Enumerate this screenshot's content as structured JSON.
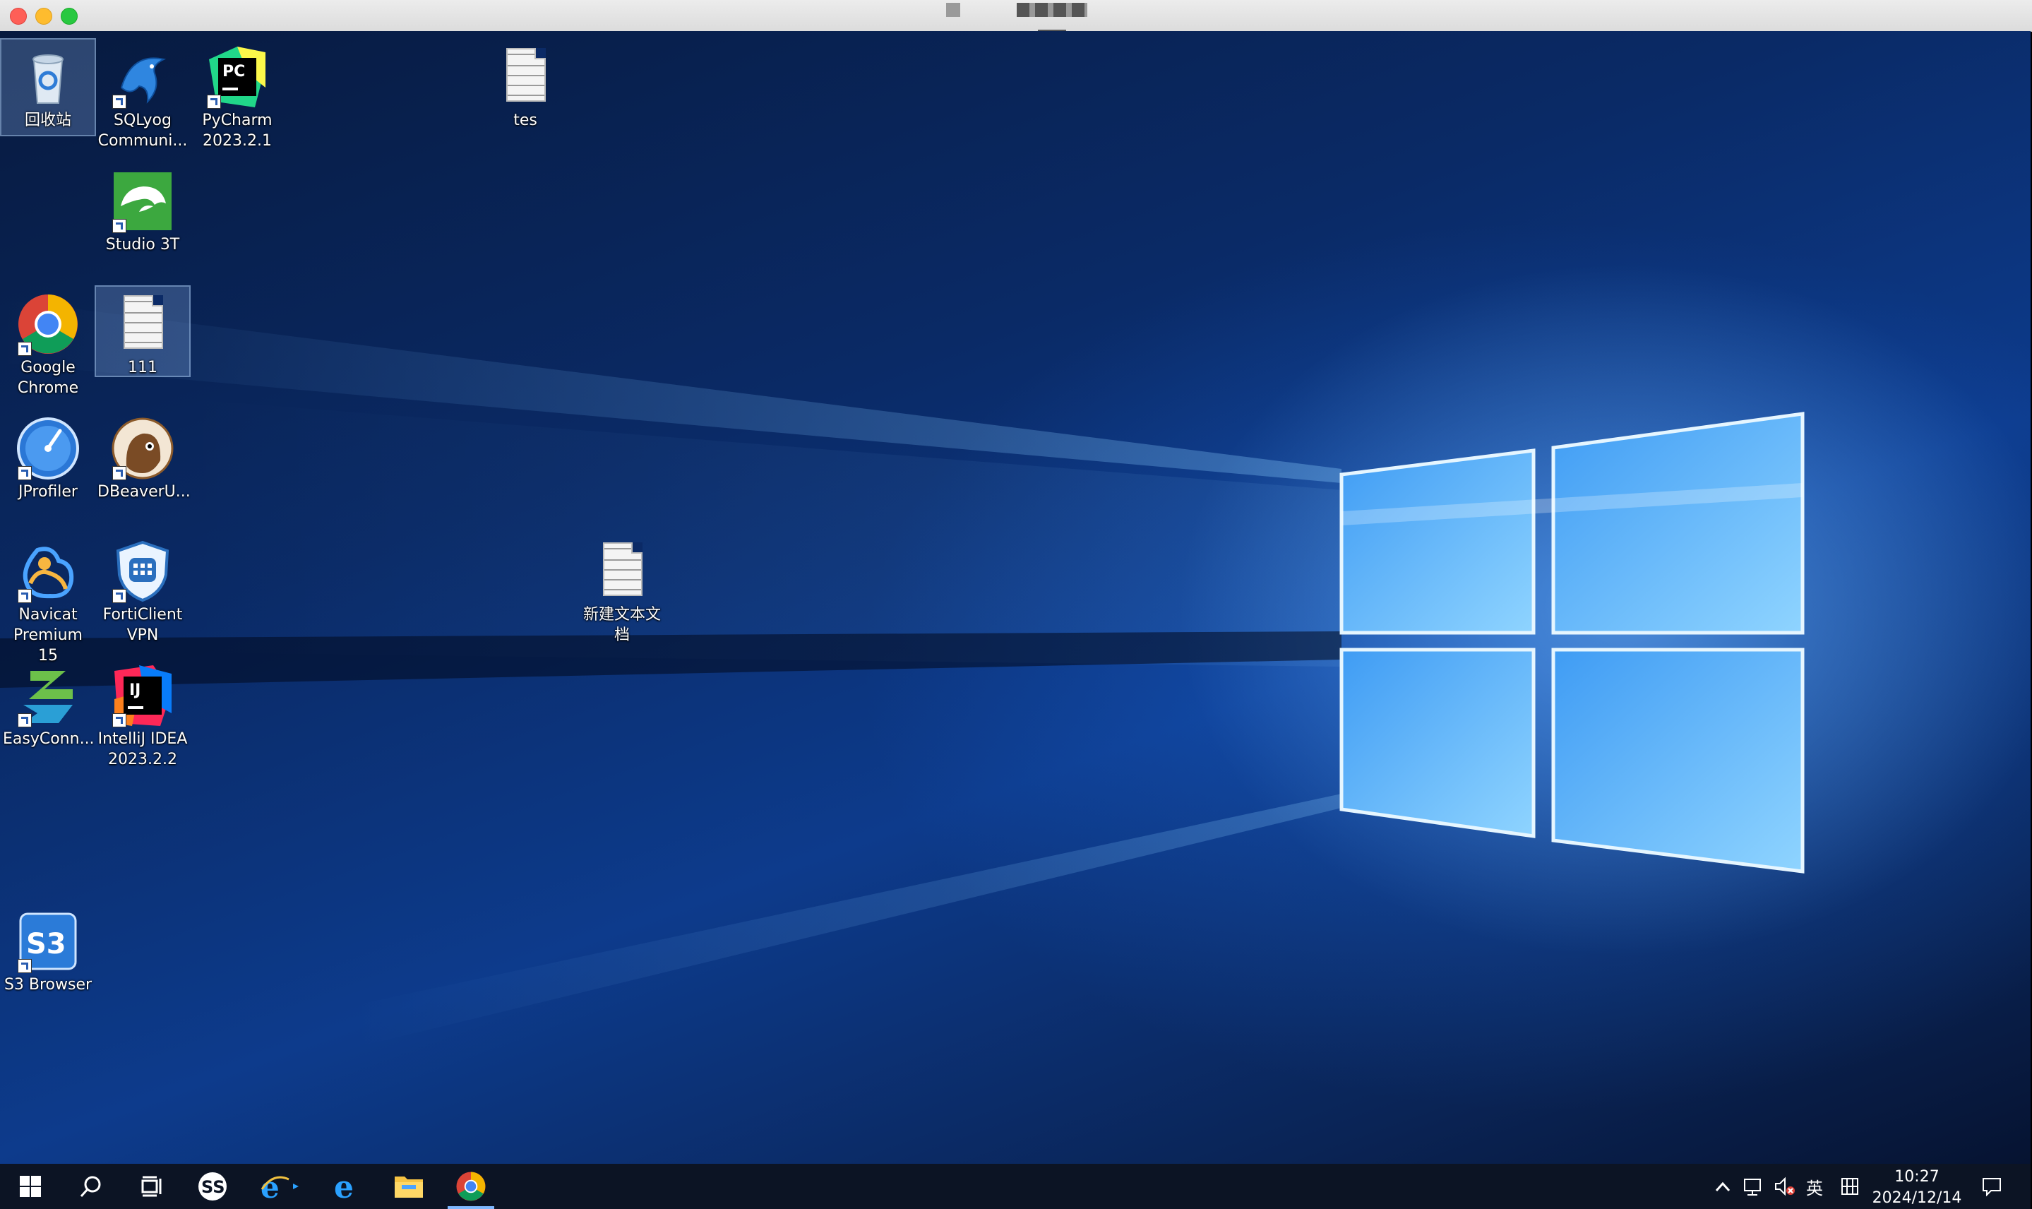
{
  "window": {
    "controls": [
      "close",
      "minimize",
      "maximize"
    ]
  },
  "desktop": {
    "icons": [
      {
        "id": "recycle-bin",
        "label": "回收站",
        "icon": "recycle-bin-icon",
        "shortcut": false,
        "selected": true
      },
      {
        "id": "sqlyog",
        "label": "SQLyog\nCommuni...",
        "icon": "sqlyog-dolphin-icon",
        "shortcut": true
      },
      {
        "id": "pycharm",
        "label": "PyCharm\n2023.2.1",
        "icon": "pycharm-icon",
        "shortcut": true
      },
      {
        "id": "tes",
        "label": "tes",
        "icon": "text-file-icon",
        "shortcut": false
      },
      {
        "id": "studio3t",
        "label": "Studio 3T",
        "icon": "studio3t-icon",
        "shortcut": true
      },
      {
        "id": "chrome",
        "label": "Google\nChrome",
        "icon": "chrome-icon",
        "shortcut": true
      },
      {
        "id": "file111",
        "label": "111",
        "icon": "text-file-icon",
        "shortcut": false,
        "selected": true
      },
      {
        "id": "jprofiler",
        "label": "JProfiler",
        "icon": "jprofiler-icon",
        "shortcut": true
      },
      {
        "id": "dbeaver",
        "label": "DBeaverU...",
        "icon": "dbeaver-icon",
        "shortcut": true
      },
      {
        "id": "new-text",
        "label": "新建文本文档",
        "icon": "text-file-icon",
        "shortcut": false
      },
      {
        "id": "navicat",
        "label": "Navicat\nPremium 15",
        "icon": "navicat-icon",
        "shortcut": true
      },
      {
        "id": "forticlient",
        "label": "FortiClient\nVPN",
        "icon": "forticlient-icon",
        "shortcut": true
      },
      {
        "id": "easyconn",
        "label": "EasyConn...",
        "icon": "easyconnect-icon",
        "shortcut": true
      },
      {
        "id": "intellij",
        "label": "IntelliJ IDEA\n2023.2.2",
        "icon": "intellij-icon",
        "shortcut": true
      },
      {
        "id": "s3browser",
        "label": "S3 Browser",
        "icon": "s3-browser-icon",
        "shortcut": true
      }
    ]
  },
  "taskbar": {
    "pinned": [
      {
        "name": "start-button",
        "icon": "windows-start-icon"
      },
      {
        "name": "search-button",
        "icon": "search-icon"
      },
      {
        "name": "task-view-button",
        "icon": "task-view-icon"
      },
      {
        "name": "app-ss-button",
        "icon": "app-ss-icon"
      },
      {
        "name": "ie-pinned-button",
        "icon": "internet-explorer-icon"
      },
      {
        "name": "edge-button",
        "icon": "edge-legacy-icon"
      },
      {
        "name": "file-explorer-button",
        "icon": "folder-icon"
      },
      {
        "name": "chrome-taskbar-button",
        "icon": "chrome-icon"
      }
    ],
    "tray": {
      "ime_label": "英",
      "time": "10:27",
      "date": "2024/12/14"
    }
  },
  "colors": {
    "taskbar": "#0c1424",
    "wallpaper_dark": "#071a3f",
    "wallpaper_light": "#4aa8ff"
  }
}
